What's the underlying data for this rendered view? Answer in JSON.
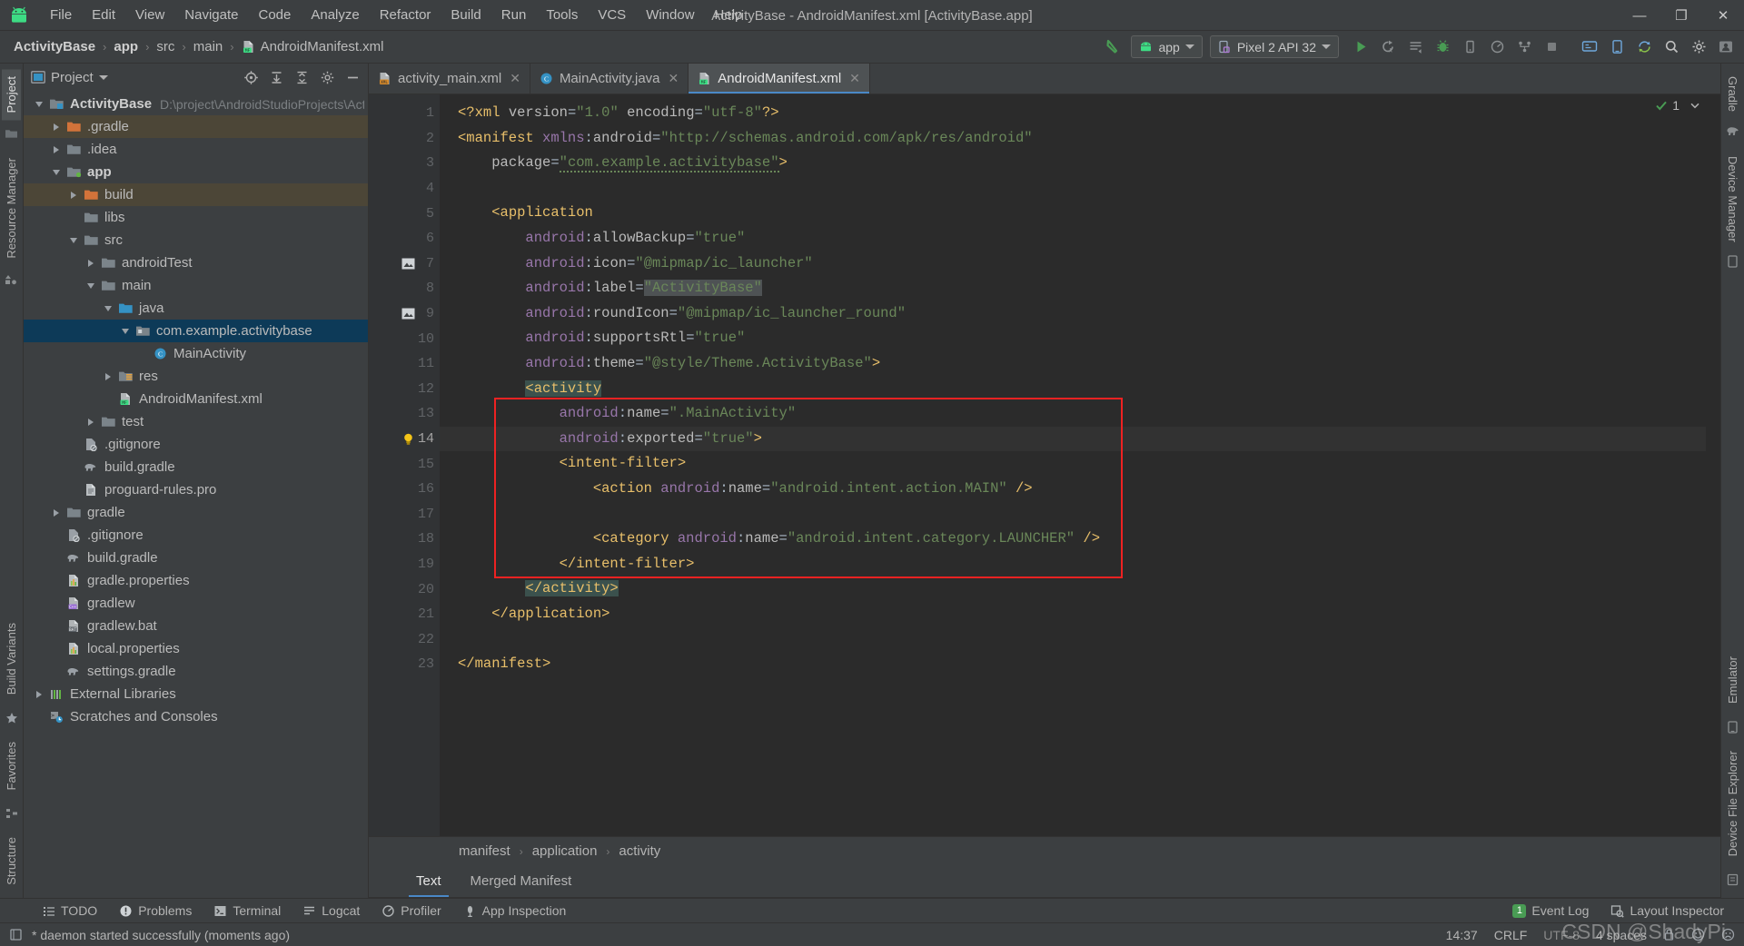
{
  "window": {
    "title": "ActivityBase - AndroidManifest.xml [ActivityBase.app]",
    "minimize": "—",
    "maximize": "❐",
    "close": "✕"
  },
  "menu": [
    {
      "label": "File"
    },
    {
      "label": "Edit"
    },
    {
      "label": "View"
    },
    {
      "label": "Navigate"
    },
    {
      "label": "Code"
    },
    {
      "label": "Analyze"
    },
    {
      "label": "Refactor"
    },
    {
      "label": "Build"
    },
    {
      "label": "Run"
    },
    {
      "label": "Tools"
    },
    {
      "label": "VCS"
    },
    {
      "label": "Window"
    },
    {
      "label": "Help"
    }
  ],
  "navbar": {
    "crumbs": [
      "ActivityBase",
      "app",
      "src",
      "main",
      "AndroidManifest.xml"
    ],
    "separator": "›",
    "module_selector": "app",
    "device_selector": "Pixel 2 API 32"
  },
  "project_panel": {
    "title": "Project",
    "tree": [
      {
        "depth": 0,
        "arrow": "open",
        "icon": "project-folder",
        "label": "ActivityBase",
        "bold": true,
        "path": "D:\\project\\AndroidStudioProjects\\ActivityBas",
        "state": "normal"
      },
      {
        "depth": 1,
        "arrow": "closed",
        "icon": "orange-folder",
        "label": ".gradle",
        "state": "tan"
      },
      {
        "depth": 1,
        "arrow": "closed",
        "icon": "folder",
        "label": ".idea",
        "state": "normal"
      },
      {
        "depth": 1,
        "arrow": "open",
        "icon": "module-folder",
        "label": "app",
        "bold": true,
        "state": "normal"
      },
      {
        "depth": 2,
        "arrow": "closed",
        "icon": "orange-folder",
        "label": "build",
        "state": "tan"
      },
      {
        "depth": 2,
        "arrow": "none",
        "icon": "folder",
        "label": "libs",
        "state": "normal"
      },
      {
        "depth": 2,
        "arrow": "open",
        "icon": "folder",
        "label": "src",
        "state": "normal"
      },
      {
        "depth": 3,
        "arrow": "closed",
        "icon": "folder",
        "label": "androidTest",
        "state": "normal"
      },
      {
        "depth": 3,
        "arrow": "open",
        "icon": "folder",
        "label": "main",
        "state": "normal"
      },
      {
        "depth": 4,
        "arrow": "open",
        "icon": "blue-folder",
        "label": "java",
        "state": "normal"
      },
      {
        "depth": 5,
        "arrow": "open",
        "icon": "package",
        "label": "com.example.activitybase",
        "state": "selected"
      },
      {
        "depth": 6,
        "arrow": "none",
        "icon": "class",
        "label": "MainActivity",
        "state": "normal"
      },
      {
        "depth": 4,
        "arrow": "closed",
        "icon": "res-folder",
        "label": "res",
        "state": "normal"
      },
      {
        "depth": 4,
        "arrow": "none",
        "icon": "manifest",
        "label": "AndroidManifest.xml",
        "state": "normal"
      },
      {
        "depth": 3,
        "arrow": "closed",
        "icon": "folder",
        "label": "test",
        "state": "normal"
      },
      {
        "depth": 2,
        "arrow": "none",
        "icon": "gitignore",
        "label": ".gitignore",
        "state": "normal"
      },
      {
        "depth": 2,
        "arrow": "none",
        "icon": "gradle",
        "label": "build.gradle",
        "state": "normal"
      },
      {
        "depth": 2,
        "arrow": "none",
        "icon": "text-file",
        "label": "proguard-rules.pro",
        "state": "normal"
      },
      {
        "depth": 1,
        "arrow": "closed",
        "icon": "folder",
        "label": "gradle",
        "state": "normal"
      },
      {
        "depth": 1,
        "arrow": "none",
        "icon": "gitignore",
        "label": ".gitignore",
        "state": "normal"
      },
      {
        "depth": 1,
        "arrow": "none",
        "icon": "gradle",
        "label": "build.gradle",
        "state": "normal"
      },
      {
        "depth": 1,
        "arrow": "none",
        "icon": "properties",
        "label": "gradle.properties",
        "state": "normal"
      },
      {
        "depth": 1,
        "arrow": "none",
        "icon": "gradlew",
        "label": "gradlew",
        "state": "normal"
      },
      {
        "depth": 1,
        "arrow": "none",
        "icon": "bat",
        "label": "gradlew.bat",
        "state": "normal"
      },
      {
        "depth": 1,
        "arrow": "none",
        "icon": "properties",
        "label": "local.properties",
        "state": "normal"
      },
      {
        "depth": 1,
        "arrow": "none",
        "icon": "gradle",
        "label": "settings.gradle",
        "state": "normal"
      },
      {
        "depth": 0,
        "arrow": "closed",
        "icon": "libraries",
        "label": "External Libraries",
        "state": "normal"
      },
      {
        "depth": 0,
        "arrow": "none",
        "icon": "scratches",
        "label": "Scratches and Consoles",
        "state": "normal"
      }
    ]
  },
  "left_rail": [
    {
      "label": "Project",
      "active": true
    },
    {
      "label": "Resource Manager",
      "active": false
    }
  ],
  "right_rail": [
    {
      "label": "Gradle"
    },
    {
      "label": "Device Manager"
    },
    {
      "label": "Device File Explorer"
    },
    {
      "label": "Emulator"
    }
  ],
  "left_rail_bottom": [
    {
      "label": "Structure"
    },
    {
      "label": "Favorites"
    },
    {
      "label": "Build Variants"
    }
  ],
  "editor_tabs": [
    {
      "label": "activity_main.xml",
      "icon": "xml-layout",
      "active": false
    },
    {
      "label": "MainActivity.java",
      "icon": "java-class",
      "active": false
    },
    {
      "label": "AndroidManifest.xml",
      "icon": "manifest",
      "active": true
    }
  ],
  "inspection_widget": {
    "count": "1"
  },
  "editor": {
    "lines": [
      {
        "n": "1",
        "fold": "none",
        "mark": "none",
        "current": false
      },
      {
        "n": "2",
        "fold": "start",
        "mark": "none",
        "current": false
      },
      {
        "n": "3",
        "fold": "none",
        "mark": "none",
        "current": false
      },
      {
        "n": "4",
        "fold": "none",
        "mark": "none",
        "current": false
      },
      {
        "n": "5",
        "fold": "start",
        "mark": "none",
        "current": false
      },
      {
        "n": "6",
        "fold": "none",
        "mark": "none",
        "current": false
      },
      {
        "n": "7",
        "fold": "none",
        "mark": "image",
        "current": false
      },
      {
        "n": "8",
        "fold": "none",
        "mark": "none",
        "current": false
      },
      {
        "n": "9",
        "fold": "none",
        "mark": "image",
        "current": false
      },
      {
        "n": "10",
        "fold": "none",
        "mark": "none",
        "current": false
      },
      {
        "n": "11",
        "fold": "none",
        "mark": "none",
        "current": false
      },
      {
        "n": "12",
        "fold": "start",
        "mark": "none",
        "current": false
      },
      {
        "n": "13",
        "fold": "none",
        "mark": "none",
        "current": false
      },
      {
        "n": "14",
        "fold": "none",
        "mark": "bulb",
        "current": true
      },
      {
        "n": "15",
        "fold": "start",
        "mark": "none",
        "current": false
      },
      {
        "n": "16",
        "fold": "none",
        "mark": "none",
        "current": false
      },
      {
        "n": "17",
        "fold": "none",
        "mark": "none",
        "current": false
      },
      {
        "n": "18",
        "fold": "none",
        "mark": "none",
        "current": false
      },
      {
        "n": "19",
        "fold": "end",
        "mark": "none",
        "current": false
      },
      {
        "n": "20",
        "fold": "end",
        "mark": "none",
        "current": false
      },
      {
        "n": "21",
        "fold": "end",
        "mark": "none",
        "current": false
      },
      {
        "n": "22",
        "fold": "none",
        "mark": "none",
        "current": false
      },
      {
        "n": "23",
        "fold": "end",
        "mark": "none",
        "current": false
      }
    ],
    "code_text": [
      "<?xml version=\"1.0\" encoding=\"utf-8\"?>",
      "<manifest xmlns:android=\"http://schemas.android.com/apk/res/android\"",
      "    package=\"com.example.activitybase\">",
      "",
      "    <application",
      "        android:allowBackup=\"true\"",
      "        android:icon=\"@mipmap/ic_launcher\"",
      "        android:label=\"ActivityBase\"",
      "        android:roundIcon=\"@mipmap/ic_launcher_round\"",
      "        android:supportsRtl=\"true\"",
      "        android:theme=\"@style/Theme.ActivityBase\">",
      "        <activity",
      "            android:name=\".MainActivity\"",
      "            android:exported=\"true\">",
      "            <intent-filter>",
      "                <action android:name=\"android.intent.action.MAIN\" />",
      "",
      "                <category android:name=\"android.intent.category.LAUNCHER\" />",
      "            </intent-filter>",
      "        </activity>",
      "    </application>",
      "",
      "</manifest>"
    ]
  },
  "xml_breadcrumbs": {
    "items": [
      "manifest",
      "application",
      "activity"
    ],
    "separator": "›"
  },
  "editor_subtabs": [
    {
      "label": "Text",
      "active": true
    },
    {
      "label": "Merged Manifest",
      "active": false
    }
  ],
  "toolwindow_bar": {
    "left": [
      {
        "label": "TODO",
        "icon": "list-icon"
      },
      {
        "label": "Problems",
        "icon": "warning-icon"
      },
      {
        "label": "Terminal",
        "icon": "terminal-icon"
      },
      {
        "label": "Logcat",
        "icon": "logcat-icon"
      },
      {
        "label": "Profiler",
        "icon": "profiler-icon"
      },
      {
        "label": "App Inspection",
        "icon": "inspection-icon"
      }
    ],
    "right": [
      {
        "label": "Event Log",
        "icon": "event-log-icon",
        "badge": "1"
      },
      {
        "label": "Layout Inspector",
        "icon": "layout-inspector-icon"
      }
    ]
  },
  "statusbar": {
    "message": "* daemon started successfully (moments ago)",
    "time": "14:37",
    "line_separator": "CRLF",
    "encoding": "UTF-8",
    "indent": "4 spaces"
  },
  "watermark": "CSDN @ShadyPi",
  "colors": {
    "accent_blue": "#4a88c7",
    "selection_blue": "#0d3a58",
    "editor_bg": "#2b2b2b",
    "panel_bg": "#3c3f41",
    "highlight_red": "#ee2222",
    "green": "#499c54",
    "string_green": "#6a8759",
    "tag_yellow": "#e8bf6a",
    "ns_purple": "#9876aa"
  }
}
